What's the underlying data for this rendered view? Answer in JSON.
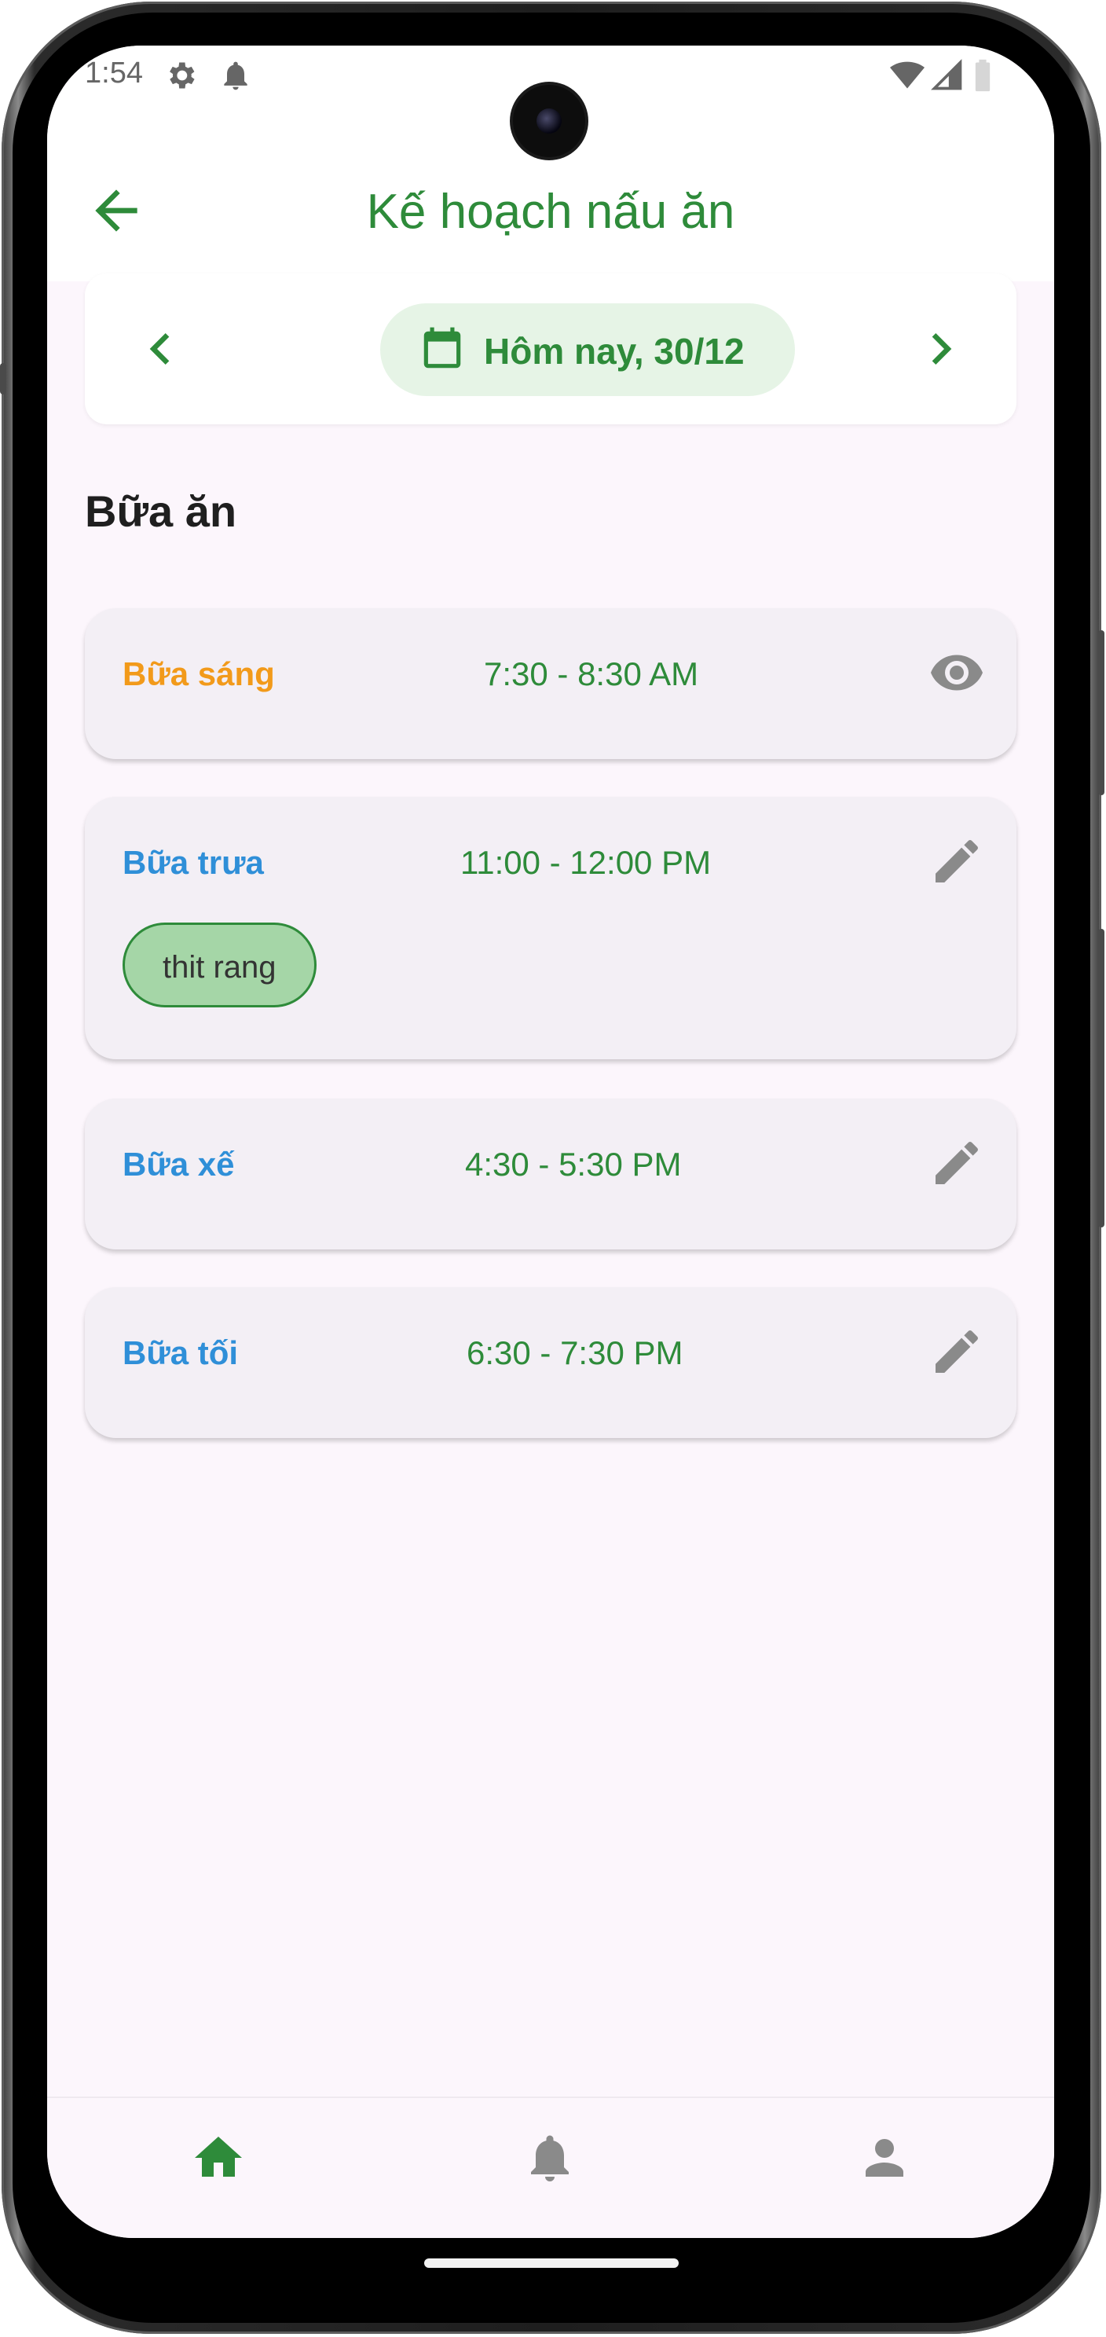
{
  "status_bar": {
    "time": "1:54"
  },
  "app_bar": {
    "title": "Kế hoạch nấu ăn"
  },
  "date_selector": {
    "label": "Hôm nay, 30/12"
  },
  "section": {
    "title": "Bữa ăn"
  },
  "meals": [
    {
      "name": "Bữa sáng",
      "time": "7:30 - 8:30 AM",
      "name_color": "#f29a1a",
      "action_icon": "eye-icon",
      "dishes": []
    },
    {
      "name": "Bữa trưa",
      "time": "11:00 - 12:00 PM",
      "name_color": "#2f8fd8",
      "action_icon": "pencil-icon",
      "dishes": [
        "thit rang"
      ]
    },
    {
      "name": "Bữa xế",
      "time": "4:30 - 5:30 PM",
      "name_color": "#2f8fd8",
      "action_icon": "pencil-icon",
      "dishes": []
    },
    {
      "name": "Bữa tối",
      "time": "6:30 - 7:30 PM",
      "name_color": "#2f8fd8",
      "action_icon": "pencil-icon",
      "dishes": []
    }
  ],
  "bottom_nav": {
    "items": [
      {
        "icon": "home-icon",
        "active": true
      },
      {
        "icon": "bell-icon",
        "active": false
      },
      {
        "icon": "person-icon",
        "active": false
      }
    ]
  },
  "colors": {
    "primary_green": "#2e8b3a",
    "breakfast_orange": "#f29a1a",
    "meal_blue": "#2f8fd8",
    "icon_gray": "#8a8a8a",
    "chip_green": "#a5d6a7"
  }
}
